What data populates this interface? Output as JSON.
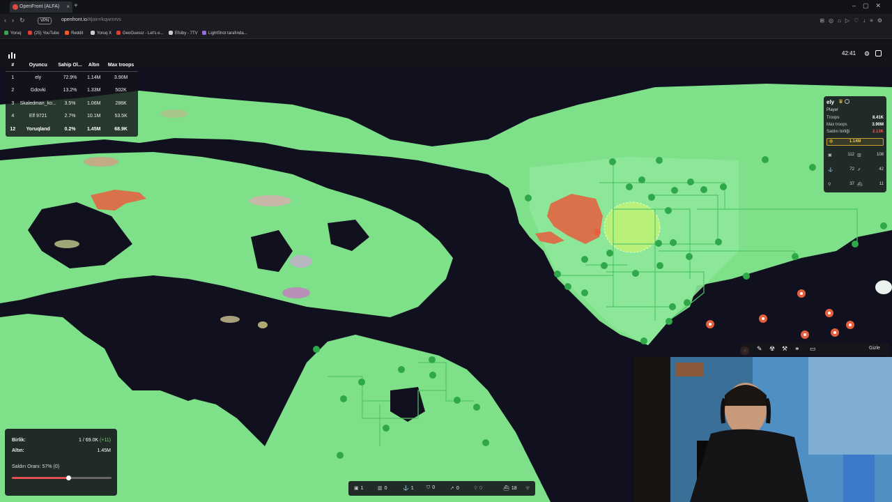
{
  "browser": {
    "tab_title": "OpenFront (ALFA)",
    "url_host": "openfront.io",
    "url_rest": "/#join=kqwrnrvs",
    "vpn_label": "VPN",
    "bookmarks": [
      {
        "label": "Yoruq",
        "color": "#3aa757"
      },
      {
        "label": "(25) YouTube",
        "color": "#e53935"
      },
      {
        "label": "Reddit",
        "color": "#ff5722"
      },
      {
        "label": "Yoruq X",
        "color": "#cccccc"
      },
      {
        "label": "GeoGuessr - Let's e...",
        "color": "#e53935"
      },
      {
        "label": "Efsiby - 7TV",
        "color": "#cccccc"
      },
      {
        "label": "LightShot tarafında...",
        "color": "#9c6ade"
      }
    ]
  },
  "leaderboard": {
    "headers": [
      "#",
      "Oyuncu",
      "Sahip Ol...",
      "Altın",
      "Max troops"
    ],
    "rows": [
      {
        "rank": "1",
        "name": "ely",
        "owned": "72.9%",
        "gold": "1.14M",
        "max_troops": "3.90M"
      },
      {
        "rank": "2",
        "name": "Gdovki",
        "owned": "13.2%",
        "gold": "1.33M",
        "max_troops": "502K"
      },
      {
        "rank": "3",
        "name": "Skaledman_ko...",
        "owned": "3.5%",
        "gold": "1.06M",
        "max_troops": "286K"
      },
      {
        "rank": "4",
        "name": "Elf 9721",
        "owned": "2.7%",
        "gold": "10.1M",
        "max_troops": "53.5K"
      },
      {
        "rank": "12",
        "name": "Yoruqland",
        "owned": "0.2%",
        "gold": "1.45M",
        "max_troops": "68.9K"
      }
    ]
  },
  "hud": {
    "timer": "42:41"
  },
  "player_panel": {
    "name": "ely",
    "type": "Player",
    "troops_label": "Troops",
    "troops_value": "8.41K",
    "max_troops_label": "Max troops",
    "max_troops_value": "3.90M",
    "attack_label": "Saldırı birliği",
    "attack_value": "2.13K",
    "gold": "1.14M",
    "stats": [
      {
        "icon": "city-icon",
        "glyph": "▣",
        "value": "112"
      },
      {
        "icon": "factory-icon",
        "glyph": "▥",
        "value": "108"
      },
      {
        "icon": "port-icon",
        "glyph": "⚓",
        "value": "72"
      },
      {
        "icon": "missile-silo-icon",
        "glyph": "➚",
        "value": "42"
      },
      {
        "icon": "sam-launcher-icon",
        "glyph": "⚲",
        "value": "37"
      },
      {
        "icon": "warship-icon",
        "glyph": "⛴",
        "value": "11"
      }
    ]
  },
  "stats_panel": {
    "troops_label": "Birlik:",
    "troops_value": "1 / 69.0K",
    "troops_gain": "(+11)",
    "gold_label": "Altın:",
    "gold_value": "1.45M",
    "attack_rate_label": "Saldırı Oranı: 57% (0)",
    "attack_rate": 0.57
  },
  "toolbar": {
    "items": [
      {
        "icon": "city-icon",
        "glyph": "▣",
        "count": "1",
        "dim": false
      },
      {
        "icon": "factory-icon",
        "glyph": "▥",
        "count": "0",
        "dim": false
      },
      {
        "icon": "port-icon",
        "glyph": "⚓",
        "count": "1",
        "dim": false
      },
      {
        "icon": "defense-post-icon",
        "glyph": "⛉",
        "count": "0",
        "dim": false
      },
      {
        "icon": "missile-silo-icon",
        "glyph": "➚",
        "count": "0",
        "dim": false
      },
      {
        "icon": "sam-launcher-icon",
        "glyph": "⚲",
        "count": "0",
        "dim": true
      },
      {
        "icon": "warship-icon",
        "glyph": "⛴",
        "count": "18",
        "dim": false
      },
      {
        "icon": "atom-bomb-icon",
        "glyph": "☢",
        "count": "",
        "dim": true
      }
    ]
  },
  "action_bar": {
    "hide_label": "Gizle"
  },
  "colors": {
    "land": "#7fe08a",
    "land_light": "#8ee89a",
    "water": "#11101f",
    "enemy": "#d9724a",
    "ally_highlight": "#b8f07a",
    "accent_gold": "#f3c43a"
  }
}
